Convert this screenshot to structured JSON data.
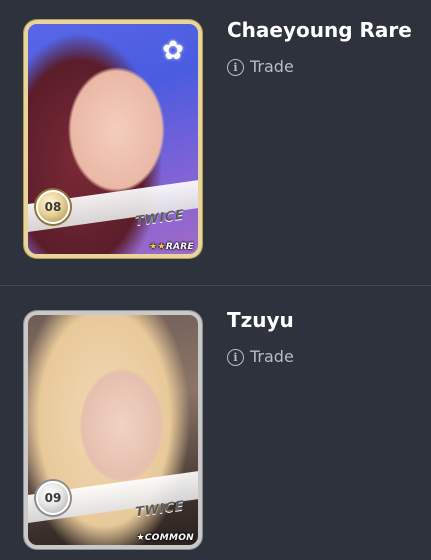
{
  "cards": [
    {
      "title": "Chaeyoung Rare",
      "trade_label": "Trade",
      "group": "TWICE",
      "number": "08",
      "rarity_stars": "★★",
      "rarity_label": "RARE",
      "icon": "info-circle-icon"
    },
    {
      "title": "Tzuyu",
      "trade_label": "Trade",
      "group": "TWICE",
      "number": "09",
      "rarity_stars": "★",
      "rarity_label": "COMMON",
      "icon": "info-circle-icon"
    }
  ],
  "colors": {
    "background": "#2d323c",
    "divider": "#454b56",
    "title": "#ffffff",
    "link": "#b8bcc4",
    "rare_frame": "#e8d59a",
    "common_frame": "#c9c9c9"
  }
}
